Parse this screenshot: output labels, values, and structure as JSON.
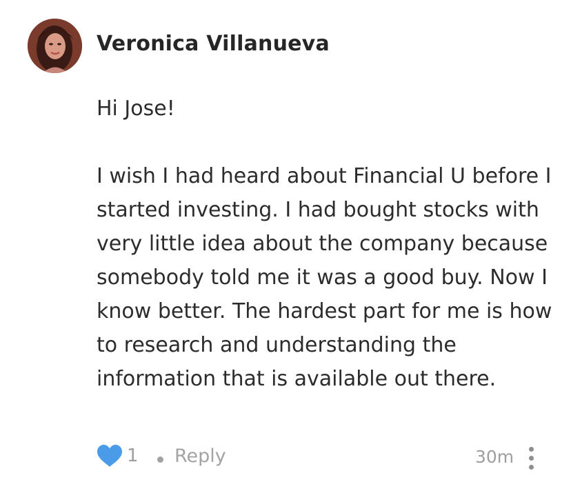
{
  "comment": {
    "author": "Veronica Villanueva",
    "greeting": "Hi Jose!",
    "body": "I wish I had heard about Financial U before I started investing. I had bought stocks with very little idea about the company because somebody told me it was a good buy. Now I know better. The hardest part for me is how to research and understanding the information that is available out there.",
    "likes": "1",
    "reply_label": "Reply",
    "time": "30m"
  },
  "icons": {
    "like": "heart-icon",
    "more": "more-vertical-icon",
    "separator": "dot"
  },
  "colors": {
    "heart": "#4a9be8",
    "meta": "#9e9e9e",
    "text": "#2c2c2c"
  }
}
